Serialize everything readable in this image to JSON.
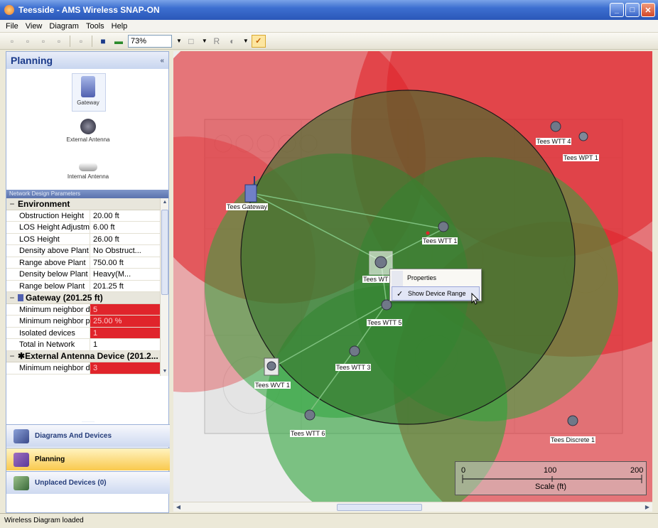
{
  "window": {
    "title": "Teesside - AMS Wireless SNAP-ON"
  },
  "menu": [
    "File",
    "View",
    "Diagram",
    "Tools",
    "Help"
  ],
  "toolbar": {
    "zoom": "73%"
  },
  "left_panel": {
    "title": "Planning",
    "toolbox": [
      {
        "label": "Gateway",
        "icon": "gateway-icon"
      },
      {
        "label": "External Antenna",
        "icon": "external-antenna-icon"
      },
      {
        "label": "Internal Antenna",
        "icon": "internal-antenna-icon"
      }
    ],
    "params_header": "Network Design Parameters",
    "environment": {
      "title": "Environment",
      "rows": [
        {
          "k": "Obstruction Height",
          "v": "20.00 ft"
        },
        {
          "k": "LOS Height Adjustm...",
          "v": "6.00 ft"
        },
        {
          "k": "LOS Height",
          "v": "26.00 ft"
        },
        {
          "k": "Density above Plant",
          "v": "No Obstruct..."
        },
        {
          "k": "Range above Plant",
          "v": "750.00 ft"
        },
        {
          "k": "Density below Plant",
          "v": "Heavy(M..."
        },
        {
          "k": "Range below Plant",
          "v": "201.25 ft"
        }
      ]
    },
    "gateway": {
      "title": "Gateway (201.25 ft)",
      "rows": [
        {
          "k": "Minimum neighbor d...",
          "v": "5"
        },
        {
          "k": "Minimum neighbor p...",
          "v": "25.00 %"
        },
        {
          "k": "Isolated devices",
          "v": "1"
        },
        {
          "k": "Total in Network",
          "v": "1"
        }
      ]
    },
    "external": {
      "title": "External Antenna Device (201.2...",
      "rows": [
        {
          "k": "Minimum neighbor d...",
          "v": "3"
        }
      ]
    },
    "nav": {
      "diagrams": "Diagrams And Devices",
      "planning": "Planning",
      "unplaced": "Unplaced Devices (0)"
    }
  },
  "canvas": {
    "devices": [
      {
        "name": "Tees Gateway",
        "type": "gateway"
      },
      {
        "name": "Tees WTT 1",
        "type": "external"
      },
      {
        "name": "Tees WTT 4",
        "type": "external"
      },
      {
        "name": "Tees WPT 1",
        "type": "external"
      },
      {
        "name": "Tees WT",
        "type": "external"
      },
      {
        "name": "Tees WTT 5",
        "type": "external"
      },
      {
        "name": "Tees WTT 3",
        "type": "external"
      },
      {
        "name": "Tees WVT 1",
        "type": "external"
      },
      {
        "name": "Tees WTT 6",
        "type": "external"
      },
      {
        "name": "Tees Discrete 1",
        "type": "external"
      }
    ],
    "context_menu": {
      "properties": "Properties",
      "show_range": "Show Device Range"
    },
    "scale": {
      "start": "0",
      "mid": "100",
      "end": "200",
      "label": "Scale (ft)"
    },
    "colors": {
      "out_of_range": "#e0242b",
      "in_range": "#2ea43a"
    }
  },
  "status": {
    "text": "Wireless Diagram loaded"
  }
}
